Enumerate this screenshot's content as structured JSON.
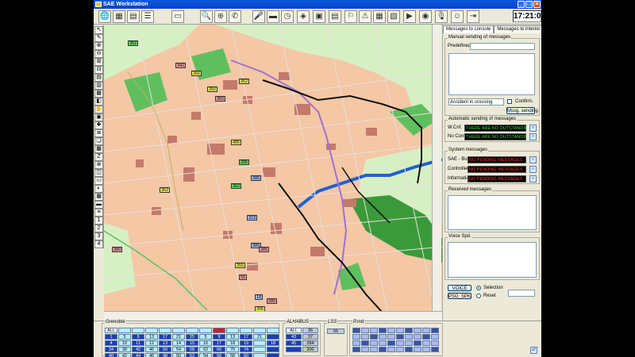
{
  "window": {
    "title": "SAE Workstation",
    "minimize": "_",
    "maximize": "□",
    "close": "✕"
  },
  "toolbar": {
    "clock": "17:21:06",
    "icons": [
      "globe-icon",
      "grid-icon",
      "grid-icon",
      "list-icon",
      "monitor-icon",
      "search-icon",
      "zoom-icon",
      "phone-icon",
      "mic-icon",
      "bus-icon",
      "clock-icon",
      "sign-icon",
      "calculator-icon",
      "camera-icon",
      "alarm-icon",
      "warning-icon",
      "table-icon",
      "image-icon",
      "video-icon",
      "gauge-icon",
      "mic-icon",
      "person-icon",
      "exit-icon"
    ],
    "glyphs": [
      "🌐",
      "▦",
      "▤",
      "☰",
      "▭",
      "🔍",
      "⊕",
      "✆",
      "🎤",
      "▬",
      "◷",
      "◈",
      "▣",
      "▤",
      "⚐",
      "⚠",
      "▦",
      "▧",
      "▶",
      "◉",
      "🎙",
      "☺",
      "⇥"
    ]
  },
  "left_tools": [
    "↖",
    "✎",
    "⊕",
    "⊖",
    "⊞",
    "⊟",
    "▤",
    "▥",
    "▦",
    "◧",
    "✋",
    "▣",
    "✚",
    "≣",
    "❏",
    "▩",
    "Z",
    "⊗",
    "◫",
    "▭",
    "◐",
    "▦",
    "▬",
    "≡",
    "1",
    "2",
    "3",
    "4"
  ],
  "map": {
    "bus_labels": [
      {
        "text": "352"
      },
      {
        "text": "352"
      },
      {
        "text": "342"
      },
      {
        "text": "366"
      },
      {
        "text": "350"
      },
      {
        "text": "350"
      },
      {
        "text": "485"
      },
      {
        "text": "285"
      },
      {
        "text": "385"
      },
      {
        "text": "323"
      },
      {
        "text": "362"
      },
      {
        "text": "362"
      },
      {
        "text": "385"
      },
      {
        "text": "385"
      },
      {
        "text": "355"
      },
      {
        "text": "55"
      },
      {
        "text": "18"
      },
      {
        "text": "280"
      },
      {
        "text": "395"
      },
      {
        "text": "380"
      }
    ]
  },
  "panel": {
    "tabs": [
      "Messages to console",
      "Messages to interior informat"
    ],
    "tab_arrows": [
      "◀",
      "▶"
    ],
    "manual": {
      "title": "Manual sending of messages",
      "predefined_label": "Predefined:",
      "predefined_value": "",
      "text": "",
      "input_value": "Accident in crossing",
      "confirm_label": "Confirm.",
      "send_button": "Mssg. sending"
    },
    "automatic": {
      "title": "Automatic sending of messages",
      "rows": [
        {
          "label": "W.Cnf.",
          "value": "THERE ARE NO OUTSTANDING"
        },
        {
          "label": "No Conf.",
          "value": "THERE ARE NO OUTSTANDING"
        }
      ]
    },
    "system": {
      "title": "System messages",
      "rows": [
        {
          "label": "SAE - Bus",
          "value": "NO PENDING MESSAGES"
        },
        {
          "label": "Controller",
          "value": "NO PENDING MESSAGES"
        },
        {
          "label": "Information",
          "value": "NO PENDING MESSAGES"
        }
      ]
    },
    "received": {
      "title": "Received messages"
    },
    "voice": {
      "title": "Voice Spd."
    },
    "buttons": {
      "voice": "VOICE",
      "psg": "PSG_SPK"
    },
    "radios": {
      "selection": "Selection",
      "reset": "Reset"
    },
    "select_value": ""
  },
  "bottom": {
    "grenoble": {
      "title": "Grenoble",
      "rows": [
        [
          "ALL",
          "",
          "",
          "",
          "",
          "",
          "",
          "",
          "",
          "",
          "",
          "",
          ""
        ],
        [
          "1",
          "5",
          "9",
          "13",
          "17",
          "21",
          "25",
          "5",
          "9",
          "13",
          "17",
          "21",
          ""
        ],
        [
          "4",
          "10",
          "11",
          "12",
          "13",
          "14",
          "15",
          "16",
          "17",
          "18",
          "19",
          "",
          "18"
        ],
        [
          "34",
          "38",
          "42",
          "46",
          "50",
          "54",
          "58",
          "62",
          "66",
          "70",
          "74",
          "",
          ""
        ],
        [
          "40",
          "42",
          "44",
          "46",
          "48",
          "50",
          "52",
          "54",
          "56",
          "58",
          "60",
          "",
          ""
        ]
      ]
    },
    "alhabus": {
      "title": "ALHABUS",
      "rows": [
        [
          "ALL",
          "36"
        ],
        [
          "43",
          "37"
        ],
        [
          "45",
          "284"
        ],
        [
          "",
          "300"
        ]
      ]
    },
    "lss": {
      "title": "LSS",
      "value": "55"
    },
    "pmd": {
      "title": "P.md"
    }
  },
  "colors": {
    "titlebar": "#0a5adb",
    "map_background": "#f4c7a5",
    "park": "#5fbf5f",
    "river": "#2060d0",
    "building": "#c47a6a",
    "dark_field": "#000000",
    "dark_field_text": "#ff3030",
    "auto_field_text": "#30e030"
  }
}
